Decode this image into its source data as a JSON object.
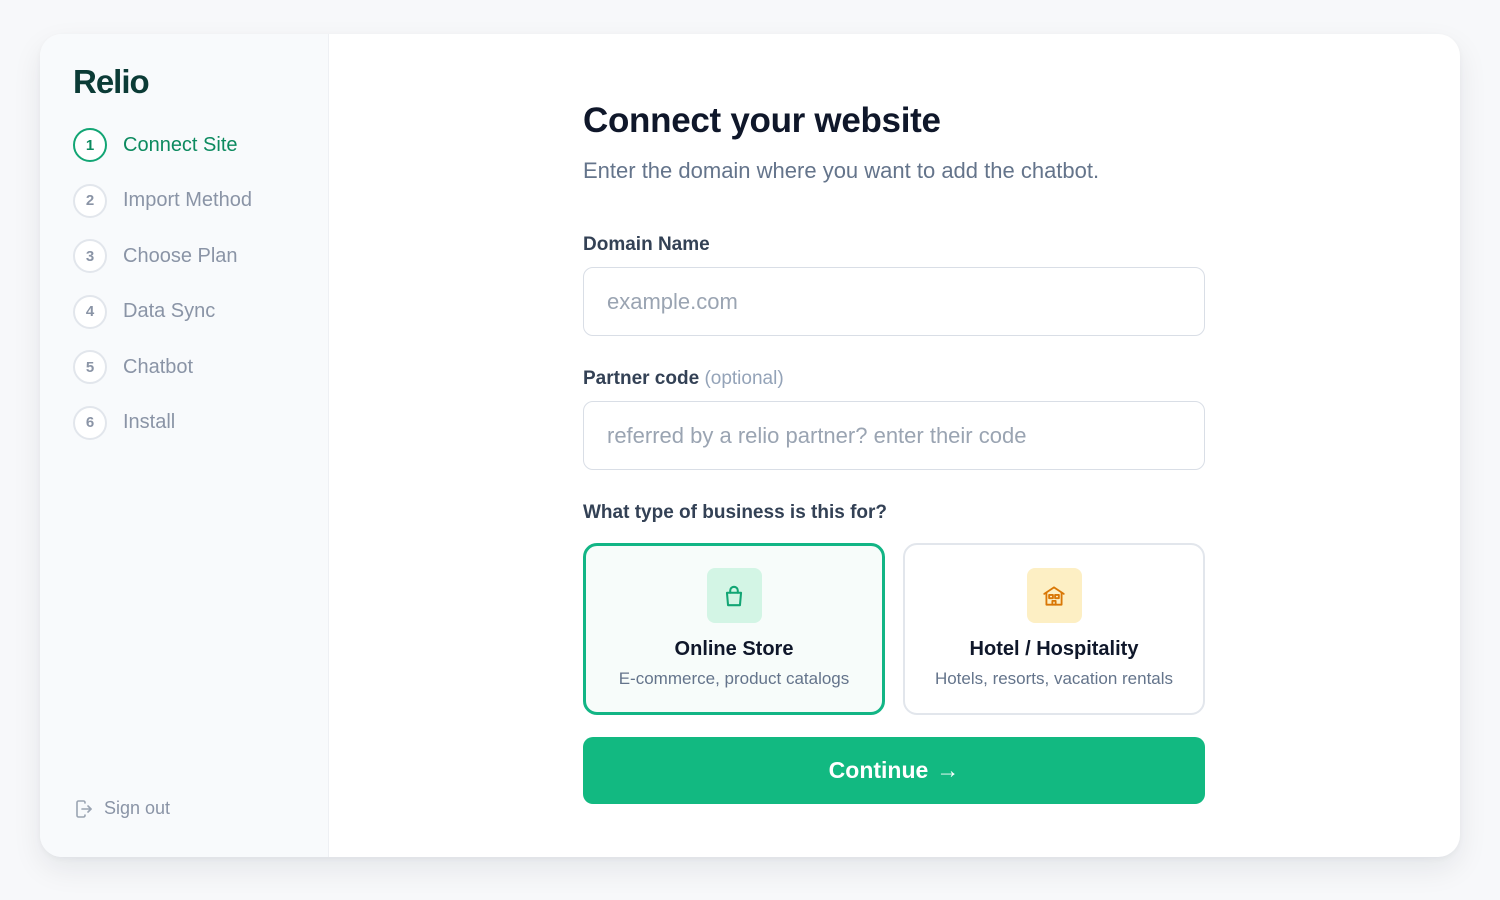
{
  "brand": {
    "name": "Relio"
  },
  "sidebar": {
    "steps": [
      {
        "number": "1",
        "label": "Connect Site",
        "active": true
      },
      {
        "number": "2",
        "label": "Import Method",
        "active": false
      },
      {
        "number": "3",
        "label": "Choose Plan",
        "active": false
      },
      {
        "number": "4",
        "label": "Data Sync",
        "active": false
      },
      {
        "number": "5",
        "label": "Chatbot",
        "active": false
      },
      {
        "number": "6",
        "label": "Install",
        "active": false
      }
    ],
    "signout_label": "Sign out"
  },
  "main": {
    "title": "Connect your website",
    "subtitle": "Enter the domain where you want to add the chatbot.",
    "domain": {
      "label": "Domain Name",
      "placeholder": "example.com",
      "value": ""
    },
    "partner": {
      "label": "Partner code",
      "optional": "(optional)",
      "placeholder": "referred by a relio partner? enter their code",
      "value": ""
    },
    "business": {
      "question": "What type of business is this for?",
      "options": [
        {
          "title": "Online Store",
          "description": "E-commerce, product catalogs",
          "icon": "shopping-bag-icon",
          "selected": true
        },
        {
          "title": "Hotel / Hospitality",
          "description": "Hotels, resorts, vacation rentals",
          "icon": "hotel-icon",
          "selected": false
        }
      ]
    },
    "continue": {
      "label": "Continue",
      "arrow": "→"
    }
  },
  "colors": {
    "accent": "#12b981",
    "accent_dark": "#0c8a5f",
    "brand_text": "#0b3b36",
    "muted": "#8a94a6",
    "selected_border": "#12b585"
  }
}
